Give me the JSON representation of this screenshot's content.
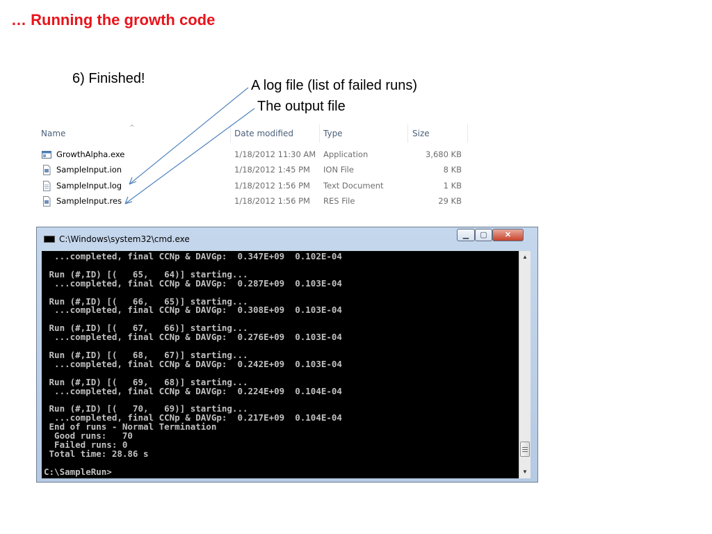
{
  "slide": {
    "title": "… Running the growth code",
    "step": "6) Finished!",
    "callout_log": "A log file (list of failed runs)",
    "callout_output": "The output file"
  },
  "explorer": {
    "columns": {
      "name": "Name",
      "date": "Date modified",
      "type": "Type",
      "size": "Size"
    },
    "files": [
      {
        "name": "GrowthAlpha.exe",
        "date": "1/18/2012 11:30 AM",
        "type": "Application",
        "size": "3,680 KB",
        "icon": "exe-icon"
      },
      {
        "name": "SampleInput.ion",
        "date": "1/18/2012 1:45 PM",
        "type": "ION File",
        "size": "8 KB",
        "icon": "file-icon"
      },
      {
        "name": "SampleInput.log",
        "date": "1/18/2012 1:56 PM",
        "type": "Text Document",
        "size": "1 KB",
        "icon": "text-file-icon"
      },
      {
        "name": "SampleInput.res",
        "date": "1/18/2012 1:56 PM",
        "type": "RES File",
        "size": "29 KB",
        "icon": "file-icon"
      }
    ]
  },
  "cmd": {
    "title": "C:\\Windows\\system32\\cmd.exe",
    "buttons": {
      "minimize": "▁",
      "maximize": "▢",
      "close": "✕"
    },
    "output": "  ...completed, final CCNp & DAVGp:  0.347E+09  0.102E-04\n\n Run (#,ID) [(   65,   64)] starting...\n  ...completed, final CCNp & DAVGp:  0.287E+09  0.103E-04\n\n Run (#,ID) [(   66,   65)] starting...\n  ...completed, final CCNp & DAVGp:  0.308E+09  0.103E-04\n\n Run (#,ID) [(   67,   66)] starting...\n  ...completed, final CCNp & DAVGp:  0.276E+09  0.103E-04\n\n Run (#,ID) [(   68,   67)] starting...\n  ...completed, final CCNp & DAVGp:  0.242E+09  0.103E-04\n\n Run (#,ID) [(   69,   68)] starting...\n  ...completed, final CCNp & DAVGp:  0.224E+09  0.104E-04\n\n Run (#,ID) [(   70,   69)] starting...\n  ...completed, final CCNp & DAVGp:  0.217E+09  0.104E-04\n End of runs - Normal Termination\n  Good runs:   70\n  Failed runs: 0\n Total time: 28.86 s\n\nC:\\SampleRun>",
    "scroll_up": "▲",
    "scroll_down": "▼"
  },
  "colors": {
    "title": "#e8141b",
    "arrow": "#4f81bd",
    "console_bg": "#000000",
    "console_text": "#c0c0c0"
  }
}
